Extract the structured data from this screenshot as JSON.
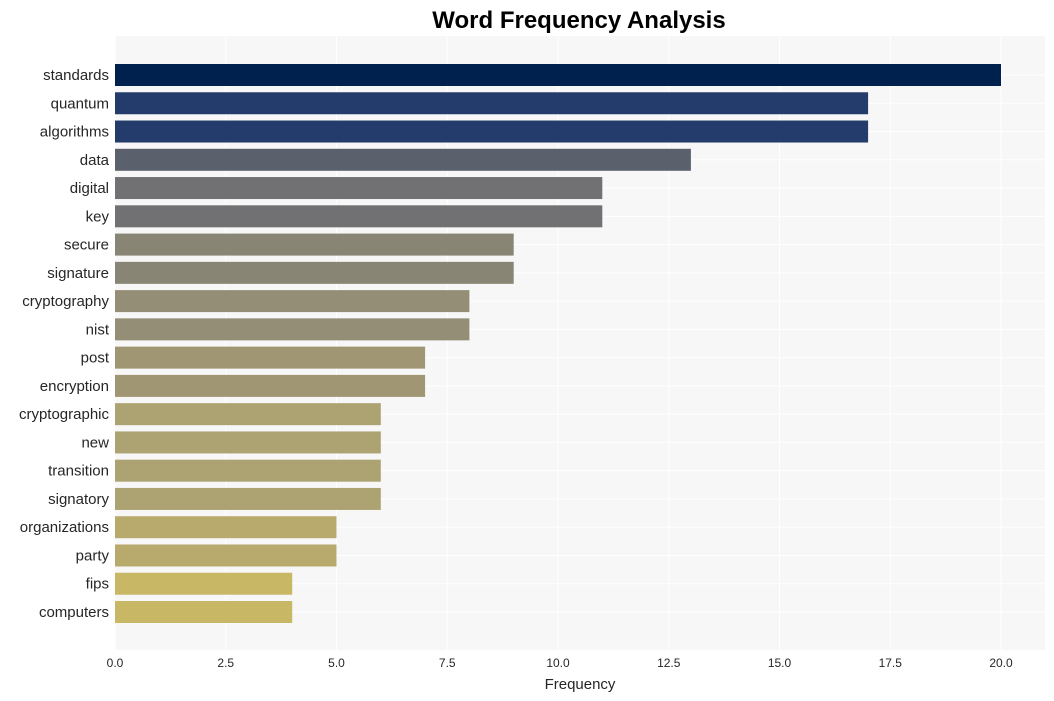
{
  "chart_data": {
    "type": "bar",
    "orientation": "horizontal",
    "title": "Word Frequency Analysis",
    "xlabel": "Frequency",
    "ylabel": "",
    "xlim": [
      0,
      21
    ],
    "xticks": [
      0.0,
      2.5,
      5.0,
      7.5,
      10.0,
      12.5,
      15.0,
      17.5,
      20.0
    ],
    "xtick_labels": [
      "0.0",
      "2.5",
      "5.0",
      "7.5",
      "10.0",
      "12.5",
      "15.0",
      "17.5",
      "20.0"
    ],
    "grid": true,
    "categories": [
      "standards",
      "quantum",
      "algorithms",
      "data",
      "digital",
      "key",
      "secure",
      "signature",
      "cryptography",
      "nist",
      "post",
      "encryption",
      "cryptographic",
      "new",
      "transition",
      "signatory",
      "organizations",
      "party",
      "fips",
      "computers"
    ],
    "values": [
      20,
      17,
      17,
      13,
      11,
      11,
      9,
      9,
      8,
      8,
      7,
      7,
      6,
      6,
      6,
      6,
      5,
      5,
      4,
      4
    ],
    "colors": [
      "#00214d",
      "#243c6c",
      "#243c6c",
      "#5b606d",
      "#717173",
      "#717173",
      "#898574",
      "#898574",
      "#958e76",
      "#958e76",
      "#a09673",
      "#a09673",
      "#ada271",
      "#ada271",
      "#ada271",
      "#ada271",
      "#b8a96c",
      "#b8a96c",
      "#c8b866",
      "#c8b866"
    ],
    "background": "#f7f7f7",
    "grid_color": "#ffffff"
  }
}
